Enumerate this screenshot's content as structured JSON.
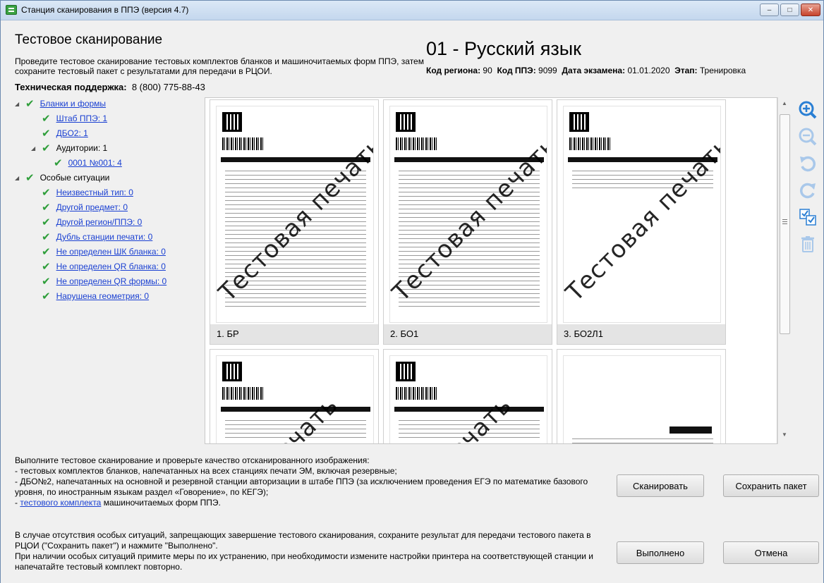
{
  "window": {
    "title": "Станция сканирования в ППЭ (версия 4.7)",
    "minimize": "–",
    "maximize": "□",
    "close": "✕"
  },
  "header": {
    "title": "Тестовое сканирование",
    "description": "Проведите тестовое сканирование тестовых комплектов бланков и машиночитаемых форм ППЭ, затем сохраните тестовый пакет с результатами для передачи в РЦОИ.",
    "support_label": "Техническая поддержка:",
    "support_phone": "8 (800) 775-88-43",
    "subject": "01 - Русский язык",
    "meta": [
      {
        "label": "Код региона:",
        "value": "90"
      },
      {
        "label": "Код ППЭ:",
        "value": "9099"
      },
      {
        "label": "Дата экзамена:",
        "value": "01.01.2020"
      },
      {
        "label": "Этап:",
        "value": "Тренировка"
      }
    ]
  },
  "tree": [
    {
      "label": "Бланки и формы",
      "link": true
    },
    {
      "label": "Штаб ППЭ: 1",
      "link": true
    },
    {
      "label": "ДБО2: 1",
      "link": true
    },
    {
      "label": "Аудитории: 1",
      "link": false
    },
    {
      "label": "0001 №001: 4",
      "link": true
    },
    {
      "label": "Особые ситуации",
      "link": false
    },
    {
      "label": "Неизвестный тип: 0",
      "link": true
    },
    {
      "label": "Другой предмет: 0",
      "link": true
    },
    {
      "label": "Другой регион/ППЭ: 0",
      "link": true
    },
    {
      "label": "Дубль станции печати: 0",
      "link": true
    },
    {
      "label": "Не определен ШК бланка: 0",
      "link": true
    },
    {
      "label": "Не определен QR бланка: 0",
      "link": true
    },
    {
      "label": "Не определен QR формы: 0",
      "link": true
    },
    {
      "label": "Нарушена геометрия: 0",
      "link": true
    }
  ],
  "thumbnails": [
    {
      "label": "1. БР",
      "watermark": "Тестовая печать"
    },
    {
      "label": "2. БО1",
      "watermark": "Тестовая печать"
    },
    {
      "label": "3. БО2Л1",
      "watermark": "Тестовая печать"
    },
    {
      "label": "",
      "watermark": "печать"
    },
    {
      "label": "",
      "watermark": "печать"
    },
    {
      "label": "",
      "watermark": ""
    }
  ],
  "tools": [
    {
      "name": "zoom-in-icon"
    },
    {
      "name": "zoom-out-icon"
    },
    {
      "name": "rotate-left-icon"
    },
    {
      "name": "rotate-right-icon"
    },
    {
      "name": "select-all-icon"
    },
    {
      "name": "delete-icon"
    }
  ],
  "instructions": {
    "line1": "Выполните тестовое сканирование и проверьте качество отсканированного изображения:",
    "line2": "- тестовых комплектов бланков, напечатанных на всех станциях печати ЭМ, включая резервные;",
    "line3": "- ДБО№2, напечатанных на основной и резервной станции авторизации в штабе ППЭ (за исключением проведения ЕГЭ по математике базового уровня, по иностранным языкам раздел «Говорение», по КЕГЭ);",
    "line4_prefix": "- ",
    "line4_link": "тестового комплекта",
    "line4_suffix": " машиночитаемых форм ППЭ.",
    "para2": "В случае отсутствия особых ситуаций, запрещающих завершение тестового сканирования, сохраните результат для передачи тестового пакета в РЦОИ (\"Сохранить пакет\") и нажмите \"Выполнено\".",
    "para3": "При наличии особых ситуаций примите меры по их устранению, при необходимости измените настройки принтера на соответствующей станции и напечатайте тестовый комплект повторно."
  },
  "buttons": {
    "scan": "Сканировать",
    "save": "Сохранить пакет",
    "done": "Выполнено",
    "cancel": "Отмена"
  }
}
